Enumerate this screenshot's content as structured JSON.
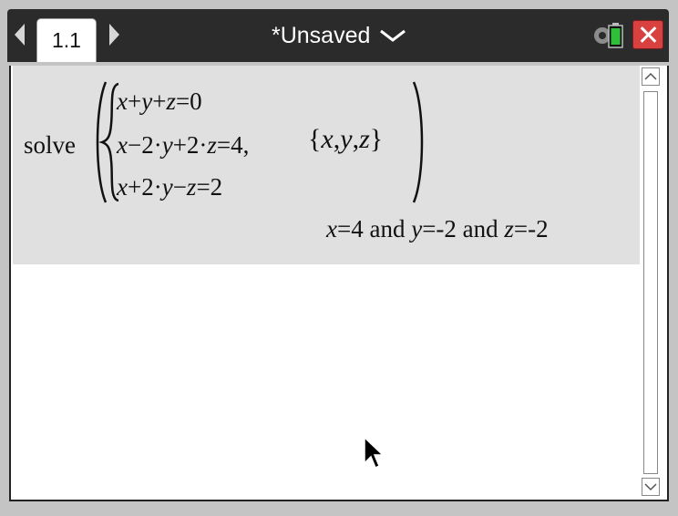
{
  "header": {
    "page_tab": "1.1",
    "document_title": "*Unsaved",
    "icons": [
      "left-arrow-icon",
      "right-arrow-icon",
      "chevron-down-icon",
      "settings-battery-icon",
      "close-icon"
    ]
  },
  "calculator": {
    "command": "solve",
    "equations": {
      "eq1": {
        "a": "x",
        "b": "+",
        "c": "y",
        "d": "+",
        "e": "z",
        "f": "=0"
      },
      "eq2": {
        "a": "x",
        "b": "−2·",
        "c": "y",
        "d": "+2·",
        "e": "z",
        "f": "=4"
      },
      "eq3": {
        "a": "x",
        "b": "+2·",
        "c": "y",
        "d": "−",
        "e": "z",
        "f": "=2"
      }
    },
    "separator": ",",
    "variables": {
      "open": "{",
      "x": "x",
      "c1": ",",
      "y": "y",
      "c2": ",",
      "z": "z",
      "close": "}"
    },
    "result": {
      "x_var": "x",
      "x_val": "=4",
      "and1": " and ",
      "y_var": "y",
      "y_val": "=-2",
      "and2": " and ",
      "z_var": "z",
      "z_val": "=-2"
    }
  },
  "colors": {
    "title_bar": "#2b2b2b",
    "entry_background": "#e0e0e0",
    "close_button": "#d94141",
    "battery": "#2fbf3a"
  }
}
